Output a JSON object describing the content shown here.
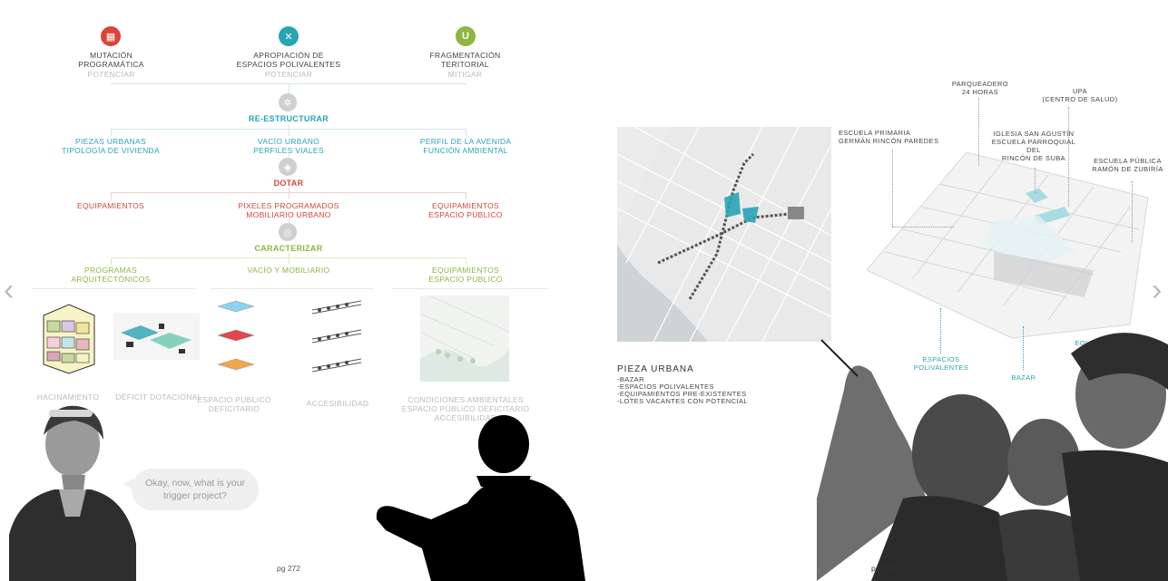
{
  "left_page": {
    "header_items": [
      {
        "title": "MUTACIÓN\nPROGRAMÁTICA",
        "status": "POTENCIAR",
        "icon": "building-icon",
        "color": "#d8443a"
      },
      {
        "title": "APROPIACIÓN DE\nESPACIOS POLIVALENTES",
        "status": "POTENCIAR",
        "icon": "cross-arrows-icon",
        "color": "#2aa3b5"
      },
      {
        "title": "FRAGMENTACIÓN\nTERITORIAL",
        "status": "MITIGAR",
        "icon": "cup-icon",
        "color": "#8fb542"
      }
    ],
    "restructure": {
      "label": "RE-ESTRUCTURAR",
      "items": [
        "PIEZAS URBANAS\nTIPOLOGÍA DE VIVIENDA",
        "VACÍO URBANO\nPERFILES VIALES",
        "PERFIL DE LA AVENIDA\nFUNCIÓN AMBIENTAL"
      ]
    },
    "dotar": {
      "label": "DOTAR",
      "items": [
        "EQUIPAMIENTOS",
        "PIXELES PROGRAMADOS\nMOBILIARIO URBANO",
        "EQUIPAMIENTOS\nESPACIO PÚBLICO"
      ]
    },
    "caracterizar": {
      "label": "CARACTERIZAR",
      "items": [
        "PROGRAMAS\nARQUITECTÓNICOS",
        "VACÍO Y MOBILIARIO",
        "EQUIPAMIENTOS\nESPACIO PÚBLICO"
      ]
    },
    "thumb_labels": [
      "HACINAMIENTO",
      "DÉFICIT DOTACIONAL",
      "ESPACIO PÚBLICO\nDEFICITARIO",
      "ACCESIBILIDAD",
      "CONDICIONES AMBIENTALES\nESPACIO PÚBLICO DEFICITARIO\nACCESIBILIDAD"
    ],
    "speech_bubble": "Okay, now, what is your\ntrigger project?",
    "page_number": "pg 272"
  },
  "right_page": {
    "pieza_title": "PIEZA URBANA",
    "pieza_items": [
      "-BAZAR",
      "-ESPACIOS POLIVALENTES",
      "-EQUIPAMIENTOS PRE-EXISTENTES",
      "-LOTES VACANTES CON POTENCIAL"
    ],
    "labels": {
      "parqueadero": "PARQUEADERO\n24 HORAS",
      "upa": "UPA\n(CENTRO DE SALUD)",
      "escuela_primaria": "ESCUELA PRIMARIA\nGERMÁN RINCÓN PAREDES",
      "iglesia": "IGLESIA SAN AGUSTÍN\nESCUELA PARROQUIAL DEL\nRINCÓN DE SUBA",
      "escuela_publica": "ESCUELA PÚBLICA\nRAMÓN DE ZUBIRÍA",
      "espacios": "ESPACIOS\nPOLIVALENTES",
      "bazar": "BAZAR",
      "equipamientos": "EQUIPAMIENTOS"
    },
    "page_number": "pg 273"
  },
  "nav": {
    "prev": "‹",
    "next": "›"
  }
}
